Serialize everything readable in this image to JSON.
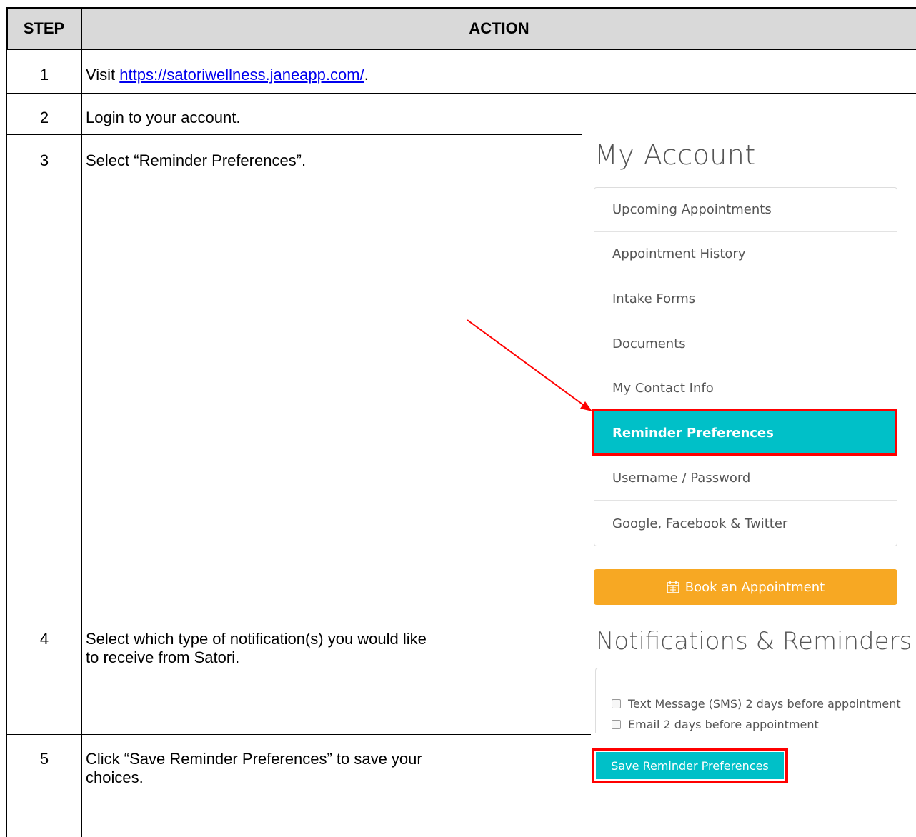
{
  "header": {
    "step": "STEP",
    "action": "ACTION"
  },
  "steps": [
    {
      "num": "1",
      "text_before": "Visit ",
      "link": "https://satoriwellness.janeapp.com/",
      "text_after": "."
    },
    {
      "num": "2",
      "text": "Login to your account."
    },
    {
      "num": "3",
      "text": "Select “Reminder Preferences”."
    },
    {
      "num": "4",
      "text_line1": "Select which type of notification(s) you would like",
      "text_line2": "to receive from Satori."
    },
    {
      "num": "5",
      "text_line1": "Click “Save Reminder Preferences” to save your",
      "text_line2": "choices."
    }
  ],
  "account": {
    "title": "My Account",
    "menu": [
      "Upcoming Appointments",
      "Appointment History",
      "Intake Forms",
      "Documents",
      "My Contact Info",
      "Reminder Preferences",
      "Username / Password",
      "Google, Facebook & Twitter"
    ],
    "active_index": 5,
    "book_button": "Book an Appointment"
  },
  "notifications": {
    "title": "Notifications & Reminders",
    "options": [
      {
        "label": "Text Message (SMS) 2 days before appointment",
        "checked": false
      },
      {
        "label": "Email 2 days before appointment",
        "checked": false
      }
    ],
    "save_button": "Save Reminder Preferences"
  },
  "colors": {
    "teal": "#00c0c8",
    "orange": "#f7a823",
    "highlight": "#ff0000",
    "header_bg": "#d9d9d9"
  },
  "icons": {
    "calendar": "calendar-icon",
    "arrow": "pointer-arrow"
  }
}
